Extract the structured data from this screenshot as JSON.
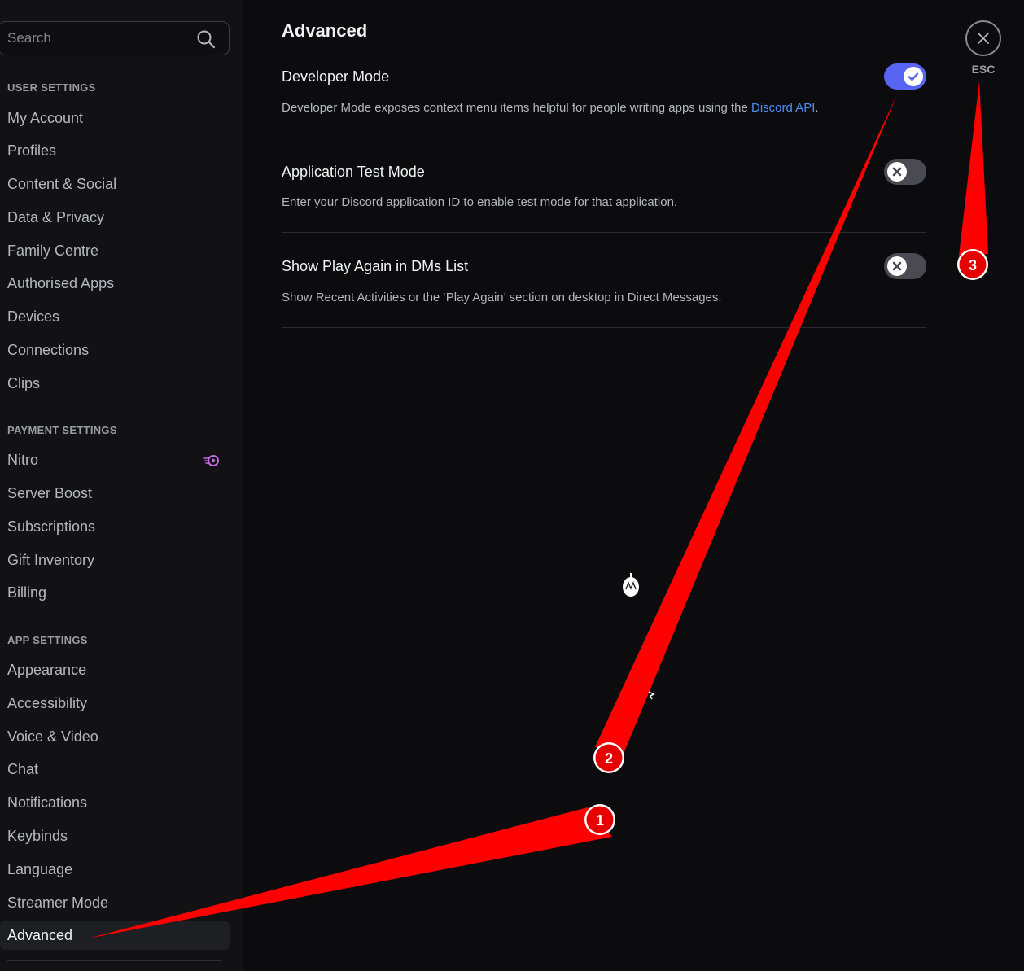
{
  "search": {
    "placeholder": "Search"
  },
  "sidebar": {
    "user_settings_header": "USER SETTINGS",
    "user_items": [
      "My Account",
      "Profiles",
      "Content & Social",
      "Data & Privacy",
      "Family Centre",
      "Authorised Apps",
      "Devices",
      "Connections",
      "Clips"
    ],
    "payment_settings_header": "PAYMENT SETTINGS",
    "payment_items": [
      "Nitro",
      "Server Boost",
      "Subscriptions",
      "Gift Inventory",
      "Billing"
    ],
    "app_settings_header": "APP SETTINGS",
    "app_items": [
      "Appearance",
      "Accessibility",
      "Voice & Video",
      "Chat",
      "Notifications",
      "Keybinds",
      "Language",
      "Streamer Mode",
      "Advanced"
    ],
    "active_item": "Advanced",
    "nitro_icon": "nitro-badge-icon",
    "nitro_icon_color": "#c769e6"
  },
  "main": {
    "title": "Advanced",
    "settings": [
      {
        "title": "Developer Mode",
        "description": "Developer Mode exposes context menu items helpful for people writing apps using the ",
        "link": "Discord API",
        "description_end": ".",
        "enabled": true
      },
      {
        "title": "Application Test Mode",
        "description": "Enter your Discord application ID to enable test mode for that application.",
        "enabled": false
      },
      {
        "title": "Show Play Again in DMs List",
        "description": "Show Recent Activities or the ‘Play Again’ section on desktop in Direct Messages.",
        "enabled": false
      }
    ],
    "close_label": "ESC"
  },
  "annotations": {
    "markers": [
      "1",
      "2",
      "3"
    ],
    "color": "#ff0000"
  },
  "colors": {
    "accent": "#5865f2",
    "link": "#4e8ef7",
    "toggle_off": "#4a4b52"
  }
}
